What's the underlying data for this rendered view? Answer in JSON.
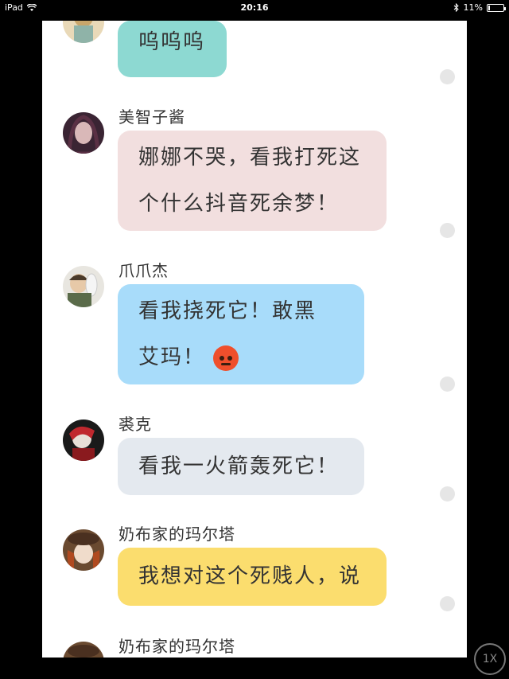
{
  "status_bar": {
    "device": "iPad",
    "time": "20:16",
    "battery_percent": "11%",
    "battery_level": 0.11
  },
  "messages": [
    {
      "name": "",
      "text": "呜呜呜",
      "bubble_color": "#8dd9d2"
    },
    {
      "name": "美智子酱",
      "text": "娜娜不哭，看我打死这个什么抖音死余梦！",
      "bubble_color": "#f2dfdf"
    },
    {
      "name": "爪爪杰",
      "text": "看我挠死它！敢黑艾玛！",
      "bubble_color": "#a8dcfa",
      "emoji": "angry-face"
    },
    {
      "name": "裘克",
      "text": "看我一火箭轰死它！",
      "bubble_color": "#e4e9ef"
    },
    {
      "name": "奶布家的玛尔塔",
      "text": "我想对这个死贱人，说",
      "bubble_color": "#fbdd6e"
    },
    {
      "name": "奶布家的玛尔塔",
      "text": ""
    }
  ],
  "playback_speed": "1X"
}
